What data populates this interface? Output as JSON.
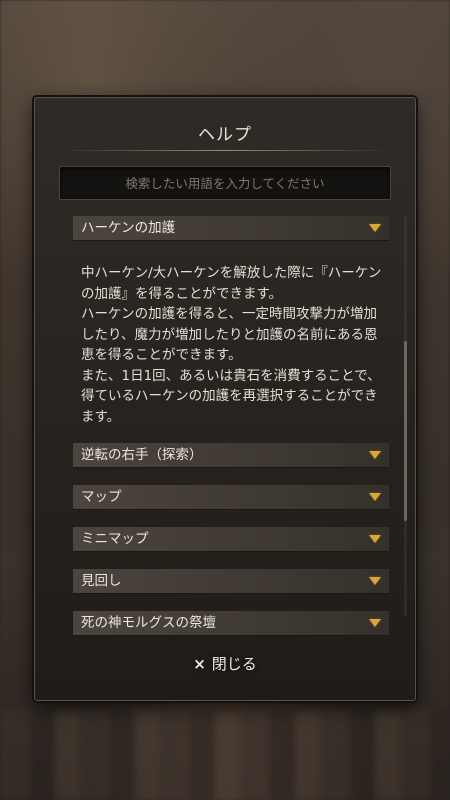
{
  "dialog": {
    "title": "ヘルプ",
    "search_placeholder": "検索したい用語を入力してください",
    "close_icon": "×",
    "close_label": "閉じる"
  },
  "sections": [
    {
      "title": "ハーケンの加護",
      "expanded": true,
      "body": [
        "中ハーケン/大ハーケンを解放した際に『ハーケンの加護』を得ることができます。",
        "ハーケンの加護を得ると、一定時間攻撃力が増加したり、魔力が増加したりと加護の名前にある恩恵を得ることができます。",
        "また、1日1回、あるいは貴石を消費することで、得ているハーケンの加護を再選択することができます。"
      ]
    },
    {
      "title": "逆転の右手（探索）",
      "expanded": false
    },
    {
      "title": "マップ",
      "expanded": false
    },
    {
      "title": "ミニマップ",
      "expanded": false
    },
    {
      "title": "見回し",
      "expanded": false
    },
    {
      "title": "死の神モルグスの祭壇",
      "expanded": false
    }
  ],
  "colors": {
    "accent_chevron": "#d9a63a",
    "text": "#e4ded4",
    "panel_bg": "#2f2b27"
  },
  "icons": {
    "expand": "chevron-down-icon",
    "close": "close-icon"
  }
}
